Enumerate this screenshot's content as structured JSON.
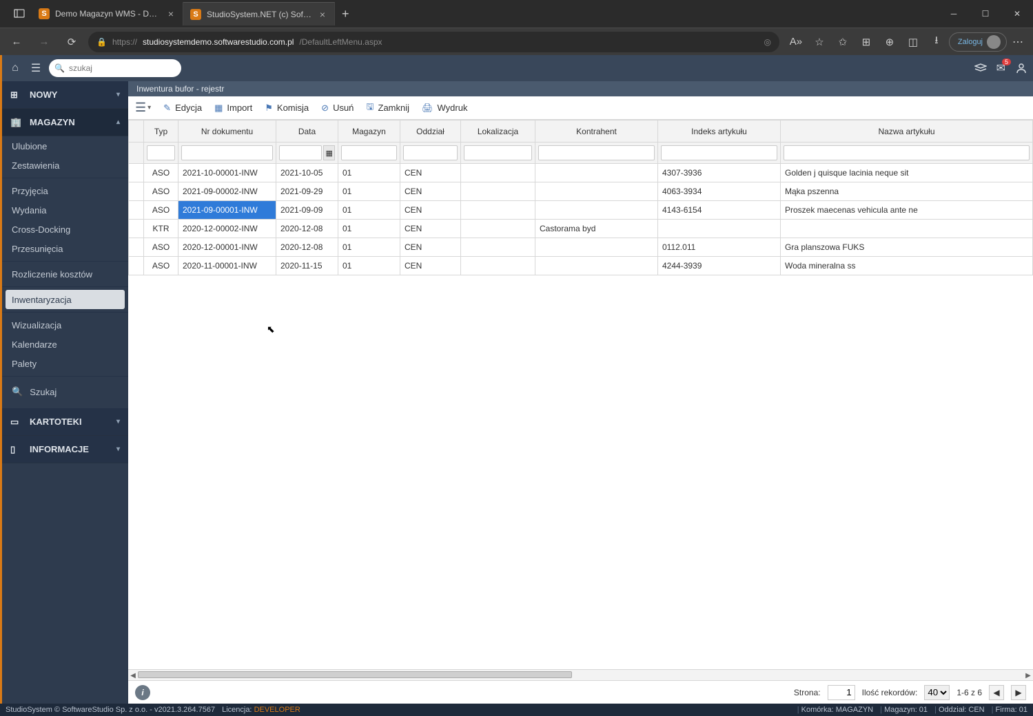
{
  "browser": {
    "tabs": [
      {
        "label": "Demo Magazyn WMS - Demo o…",
        "active": false
      },
      {
        "label": "StudioSystem.NET (c) SoftwareSt…",
        "active": true
      }
    ],
    "url_proto": "https://",
    "url_domain": "studiosystemdemo.softwarestudio.com.pl",
    "url_path": "/DefaultLeftMenu.aspx",
    "login": "Zaloguj"
  },
  "search_placeholder": "szukaj",
  "notif_count": "5",
  "side": {
    "nowy": "NOWY",
    "magazyn": "MAGAZYN",
    "items_top": [
      "Ulubione",
      "Zestawienia"
    ],
    "items_mid": [
      "Przyjęcia",
      "Wydania",
      "Cross-Docking",
      "Przesunięcia"
    ],
    "items_roz": "Rozliczenie kosztów",
    "items_inw": "Inwentaryzacja",
    "items_bot": [
      "Wizualizacja",
      "Kalendarze",
      "Palety"
    ],
    "szukaj": "Szukaj",
    "kartoteki": "KARTOTEKI",
    "informacje": "INFORMACJE"
  },
  "page_title": "Inwentura bufor - rejestr",
  "toolbar": {
    "edycja": "Edycja",
    "import": "Import",
    "komisja": "Komisja",
    "usun": "Usuń",
    "zamknij": "Zamknij",
    "wydruk": "Wydruk"
  },
  "cols": [
    "Typ",
    "Nr dokumentu",
    "Data",
    "Magazyn",
    "Oddział",
    "Lokalizacja",
    "Kontrahent",
    "Indeks artykułu",
    "Nazwa artykułu"
  ],
  "rows": [
    {
      "typ": "ASO",
      "nr": "2021-10-00001-INW",
      "data": "2021-10-05",
      "mag": "01",
      "odd": "CEN",
      "lok": "",
      "kon": "",
      "idx": "4307-3936",
      "naz": "Golden j quisque lacinia neque sit"
    },
    {
      "typ": "ASO",
      "nr": "2021-09-00002-INW",
      "data": "2021-09-29",
      "mag": "01",
      "odd": "CEN",
      "lok": "",
      "kon": "",
      "idx": "4063-3934",
      "naz": "Mąka pszenna"
    },
    {
      "typ": "ASO",
      "nr": "2021-09-00001-INW",
      "data": "2021-09-09",
      "mag": "01",
      "odd": "CEN",
      "lok": "",
      "kon": "",
      "idx": "4143-6154",
      "naz": "Proszek maecenas vehicula ante ne"
    },
    {
      "typ": "KTR",
      "nr": "2020-12-00002-INW",
      "data": "2020-12-08",
      "mag": "01",
      "odd": "CEN",
      "lok": "",
      "kon": "Castorama byd",
      "idx": "",
      "naz": ""
    },
    {
      "typ": "ASO",
      "nr": "2020-12-00001-INW",
      "data": "2020-12-08",
      "mag": "01",
      "odd": "CEN",
      "lok": "",
      "kon": "",
      "idx": "0112.011",
      "naz": "Gra planszowa FUKS"
    },
    {
      "typ": "ASO",
      "nr": "2020-11-00001-INW",
      "data": "2020-11-15",
      "mag": "01",
      "odd": "CEN",
      "lok": "",
      "kon": "",
      "idx": "4244-3939",
      "naz": "Woda mineralna ss"
    }
  ],
  "selected_row": 2,
  "selected_col": "nr",
  "footer": {
    "strona": "Strona:",
    "page": "1",
    "ilosc": "Ilość rekordów:",
    "pagesize": "40",
    "range": "1-6 z 6"
  },
  "status": {
    "left": "StudioSystem © SoftwareStudio Sp. z o.o. - v2021.3.264.7567",
    "lic_lbl": "Licencja: ",
    "lic_val": "DEVELOPER",
    "komorka": "Komórka: MAGAZYN",
    "magazyn": "Magazyn: 01",
    "oddzial": "Oddział: CEN",
    "firma": "Firma: 01"
  }
}
